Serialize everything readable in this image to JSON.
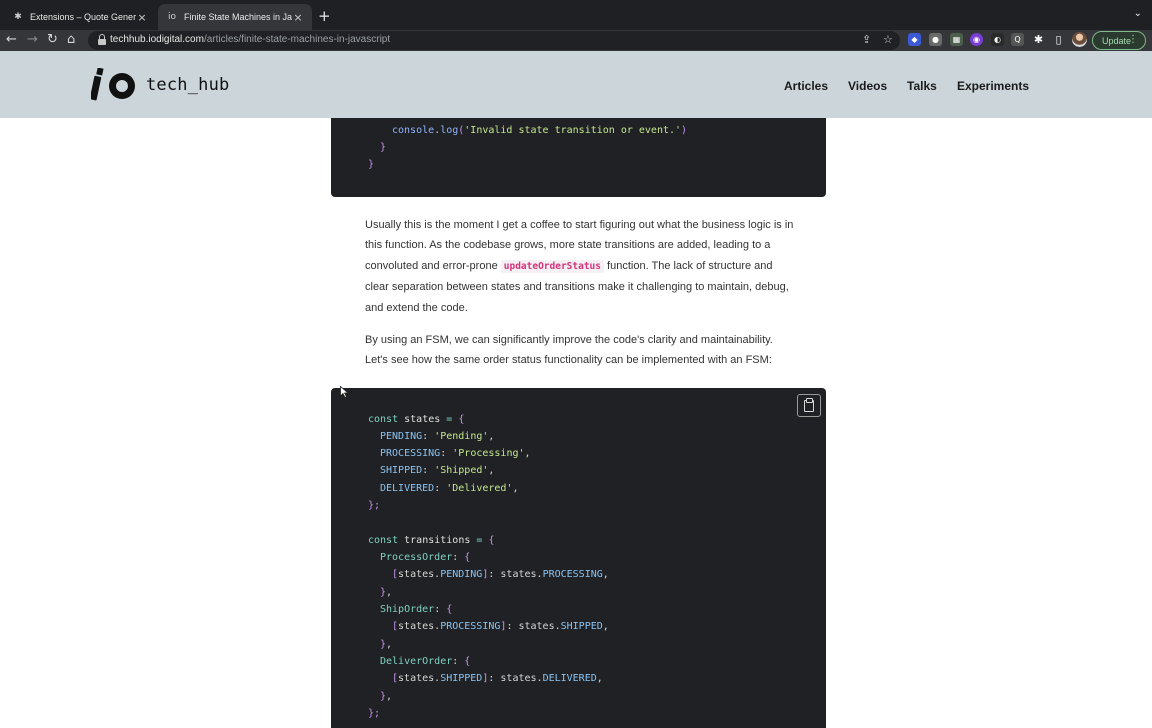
{
  "browser": {
    "tabs": [
      {
        "title": "Extensions – Quote Generator",
        "icon": "puzzle-icon",
        "close": "×"
      },
      {
        "title": "Finite State Machines in JavaS",
        "icon": "io-favicon",
        "close": "×"
      }
    ],
    "new_tab": "+",
    "tab_menu": "⌄",
    "url_domain": "techhub.iodigital.com",
    "url_path": "/articles/finite-state-machines-in-javascript",
    "update_label": "Update"
  },
  "site": {
    "logo_text": "tech_hub",
    "nav": [
      "Articles",
      "Videos",
      "Talks",
      "Experiments"
    ]
  },
  "article": {
    "paragraph1_before": "Usually this is the moment I get a coffee to start figuring out what the business logic is in this function. As the codebase grows, more state transitions are added, leading to a convoluted and error-prone ",
    "paragraph1_code": "updateOrderStatus",
    "paragraph1_after": " function. The lack of structure and clear separation between states and transitions make it challenging to maintain, debug, and extend the code.",
    "paragraph2": "By using an FSM, we can significantly improve the code's clarity and maintainability. Let's see how the same order status functionality can be implemented with an FSM:"
  },
  "code_top_lines": [
    "console.log('Invalid state transition or event.')",
    "}",
    "}"
  ],
  "code_main_lines": [
    "const states = {",
    "PENDING: 'Pending',",
    "PROCESSING: 'Processing',",
    "SHIPPED: 'Shipped',",
    "DELIVERED: 'Delivered',",
    "};",
    "",
    "const transitions = {",
    "ProcessOrder: {",
    "[states.PENDING]: states.PROCESSING,",
    "},",
    "ShipOrder: {",
    "[states.PROCESSING]: states.SHIPPED,",
    "},",
    "DeliverOrder: {",
    "[states.SHIPPED]: states.DELIVERED,",
    "},",
    "};"
  ],
  "colors": {
    "header_bg": "#cbd5da",
    "code_bg": "#202124",
    "inline_code": "#d6337a"
  }
}
